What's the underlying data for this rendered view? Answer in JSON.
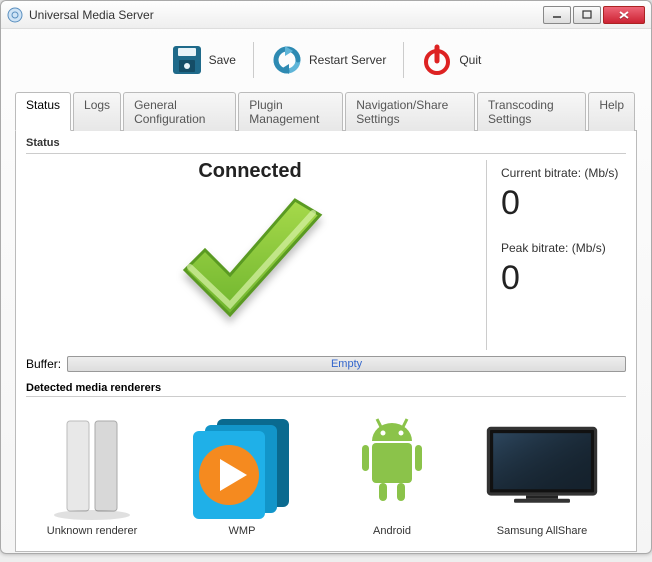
{
  "window": {
    "title": "Universal Media Server"
  },
  "toolbar": {
    "save": "Save",
    "restart": "Restart Server",
    "quit": "Quit"
  },
  "tabs": {
    "status": "Status",
    "logs": "Logs",
    "general": "General Configuration",
    "plugin": "Plugin Management",
    "nav": "Navigation/Share Settings",
    "transcoding": "Transcoding Settings",
    "help": "Help"
  },
  "status": {
    "group_label": "Status",
    "connected": "Connected",
    "current_bitrate_label": "Current bitrate: (Mb/s)",
    "current_bitrate_value": "0",
    "peak_bitrate_label": "Peak bitrate: (Mb/s)",
    "peak_bitrate_value": "0",
    "buffer_label": "Buffer:",
    "buffer_text": "Empty"
  },
  "renderers": {
    "group_label": "Detected media renderers",
    "items": [
      {
        "name": "Unknown renderer"
      },
      {
        "name": "WMP"
      },
      {
        "name": "Android"
      },
      {
        "name": "Samsung AllShare"
      }
    ]
  }
}
